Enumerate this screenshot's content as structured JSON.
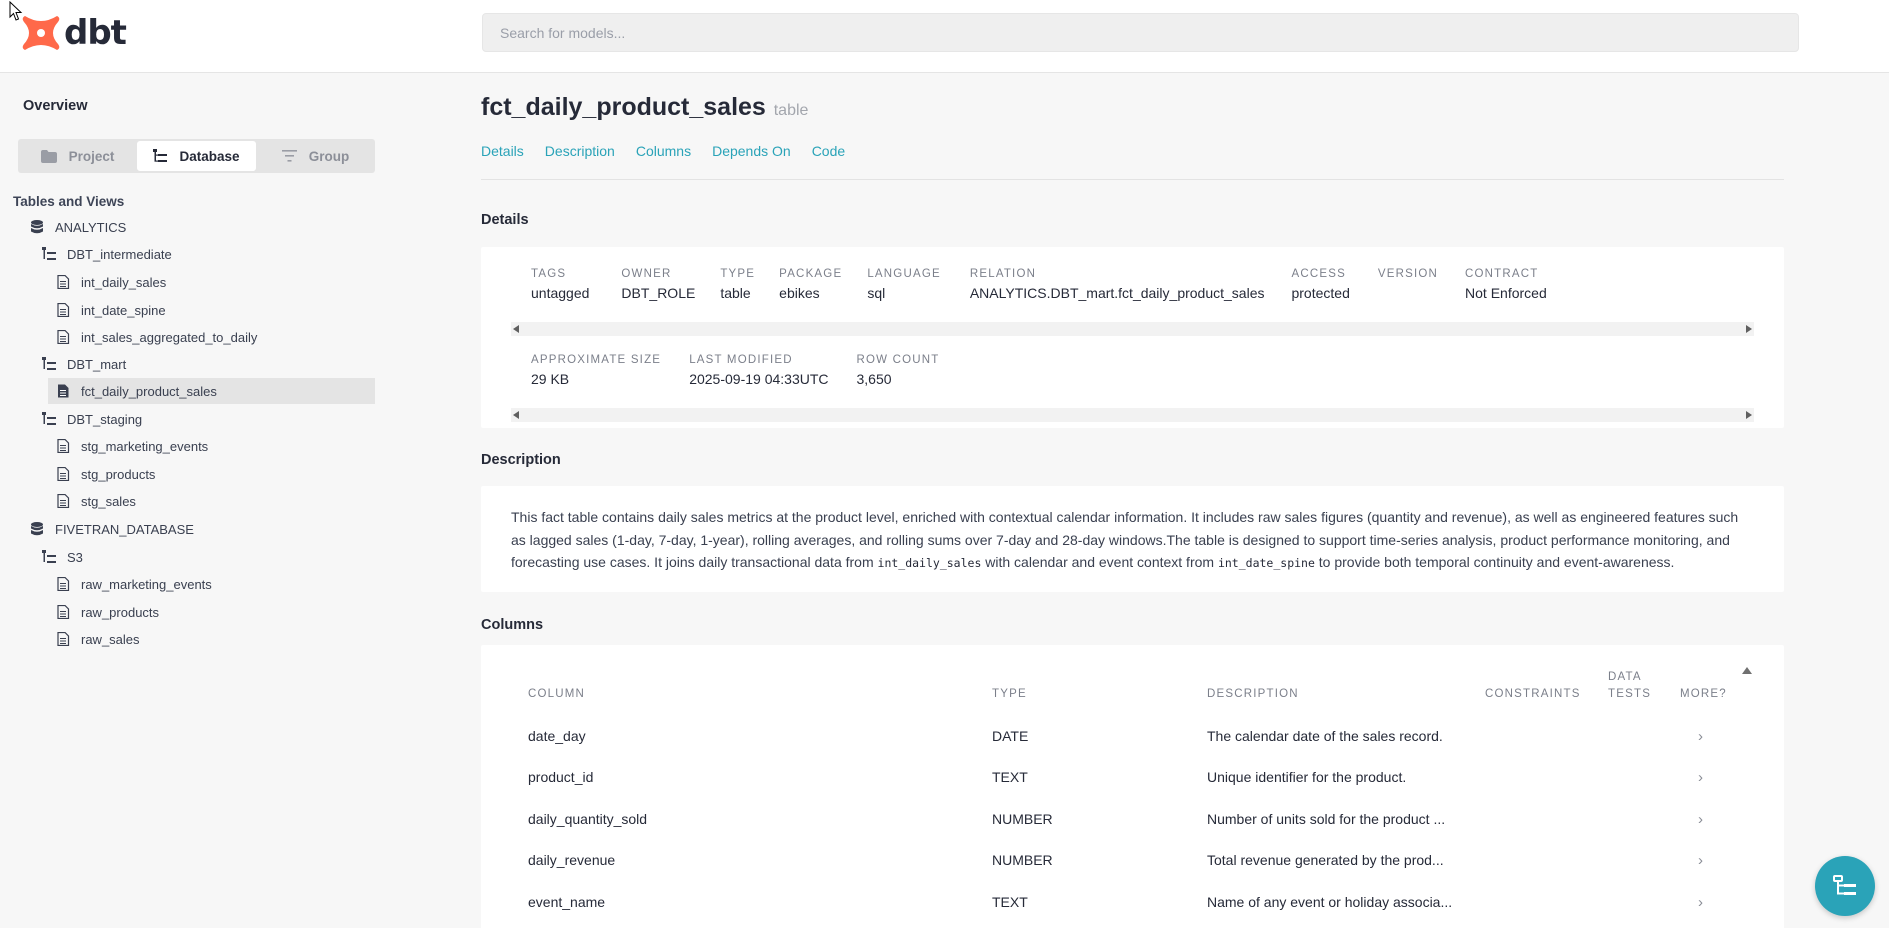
{
  "header": {
    "logo_text": "dbt",
    "search_placeholder": "Search for models..."
  },
  "sidebar": {
    "overview": "Overview",
    "tabs": [
      {
        "label": "Project",
        "icon": "folder-icon"
      },
      {
        "label": "Database",
        "icon": "tree-icon",
        "active": true
      },
      {
        "label": "Group",
        "icon": "filter-icon"
      }
    ],
    "section_title": "Tables and Views",
    "tree": [
      {
        "label": "ANALYTICS",
        "type": "database"
      },
      {
        "label": "DBT_intermediate",
        "type": "schema"
      },
      {
        "label": "int_daily_sales",
        "type": "table"
      },
      {
        "label": "int_date_spine",
        "type": "table"
      },
      {
        "label": "int_sales_aggregated_to_daily",
        "type": "table"
      },
      {
        "label": "DBT_mart",
        "type": "schema"
      },
      {
        "label": "fct_daily_product_sales",
        "type": "table",
        "selected": true
      },
      {
        "label": "DBT_staging",
        "type": "schema"
      },
      {
        "label": "stg_marketing_events",
        "type": "table"
      },
      {
        "label": "stg_products",
        "type": "table"
      },
      {
        "label": "stg_sales",
        "type": "table"
      },
      {
        "label": "FIVETRAN_DATABASE",
        "type": "database"
      },
      {
        "label": "S3",
        "type": "schema"
      },
      {
        "label": "raw_marketing_events",
        "type": "table"
      },
      {
        "label": "raw_products",
        "type": "table"
      },
      {
        "label": "raw_sales",
        "type": "table"
      }
    ]
  },
  "main": {
    "model_name": "fct_daily_product_sales",
    "model_kind": "table",
    "anchors": [
      "Details",
      "Description",
      "Columns",
      "Depends On",
      "Code"
    ],
    "details_title": "Details",
    "details_row1": [
      {
        "key": "TAGS",
        "value": "untagged"
      },
      {
        "key": "OWNER",
        "value": "DBT_ROLE"
      },
      {
        "key": "TYPE",
        "value": "table"
      },
      {
        "key": "PACKAGE",
        "value": "ebikes"
      },
      {
        "key": "LANGUAGE",
        "value": "sql"
      },
      {
        "key": "RELATION",
        "value": "ANALYTICS.DBT_mart.fct_daily_product_sales"
      },
      {
        "key": "ACCESS",
        "value": "protected"
      },
      {
        "key": "VERSION",
        "value": ""
      },
      {
        "key": "CONTRACT",
        "value": "Not Enforced"
      }
    ],
    "details_row2": [
      {
        "key": "APPROXIMATE SIZE",
        "value": "29 KB"
      },
      {
        "key": "LAST MODIFIED",
        "value": "2025-09-19 04:33UTC"
      },
      {
        "key": "ROW COUNT",
        "value": "3,650"
      }
    ],
    "description_title": "Description",
    "description": {
      "part1": "This fact table contains daily sales metrics at the product level, enriched with contextual calendar information. It includes raw sales figures (quantity and revenue), as well as engineered features such as lagged sales (1-day, 7-day, 1-year), rolling averages, and rolling sums over 7-day and 28-day windows.The table is designed to support time-series analysis, product performance monitoring, and forecasting use cases. It joins daily transactional data from ",
      "code1": "int_daily_sales",
      "part2": " with calendar and event context from ",
      "code2": "int_date_spine",
      "part3": " to provide both temporal continuity and event-awareness."
    },
    "columns_title": "Columns",
    "column_headers": {
      "column": "COLUMN",
      "type": "TYPE",
      "description": "DESCRIPTION",
      "constraints": "CONSTRAINTS",
      "data_tests_1": "DATA",
      "data_tests_2": "TESTS",
      "more": "MORE?"
    },
    "columns": [
      {
        "name": "date_day",
        "type": "DATE",
        "description": "The calendar date of the sales record."
      },
      {
        "name": "product_id",
        "type": "TEXT",
        "description": "Unique identifier for the product."
      },
      {
        "name": "daily_quantity_sold",
        "type": "NUMBER",
        "description": "Number of units sold for the product ..."
      },
      {
        "name": "daily_revenue",
        "type": "NUMBER",
        "description": "Total revenue generated by the prod..."
      },
      {
        "name": "event_name",
        "type": "TEXT",
        "description": "Name of any event or holiday associa..."
      }
    ],
    "chevron": "›"
  },
  "colors": {
    "accent": "#2aa3b8",
    "logo": "#ff694a",
    "text": "#262a38"
  }
}
